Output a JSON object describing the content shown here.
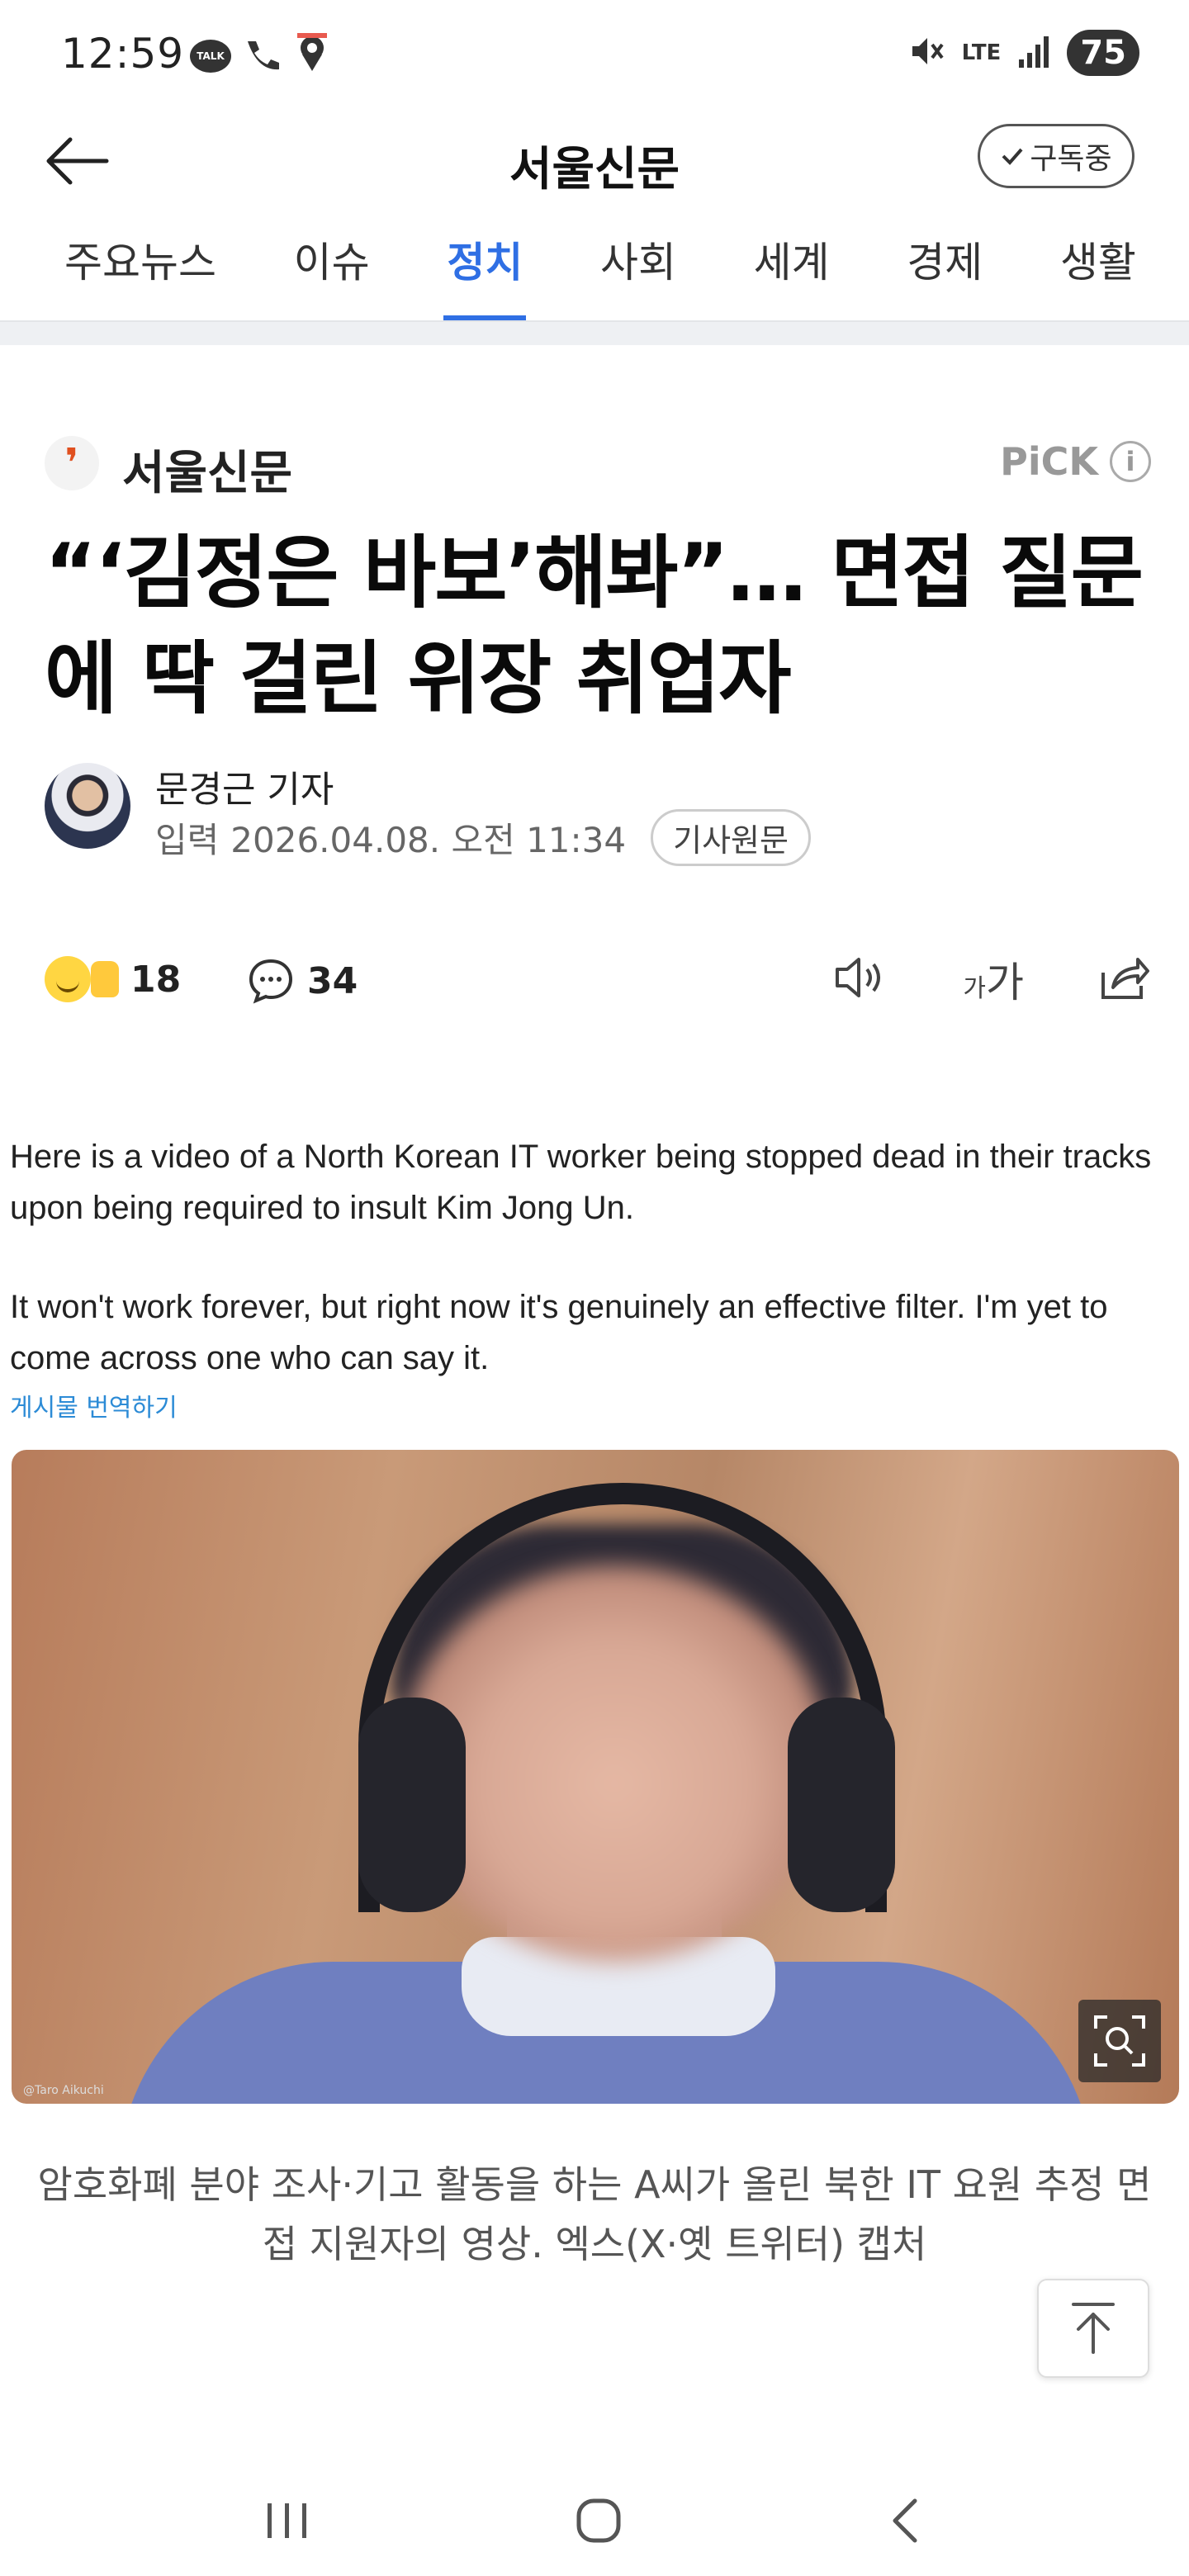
{
  "status_bar": {
    "time": "12:59",
    "talk_badge": "TALK",
    "battery": "75",
    "network": "LTE"
  },
  "header": {
    "title": "서울신문",
    "subscribe_label": "구독중"
  },
  "tabs": [
    {
      "label": "주요뉴스",
      "active": false
    },
    {
      "label": "이슈",
      "active": false
    },
    {
      "label": "정치",
      "active": true
    },
    {
      "label": "사회",
      "active": false
    },
    {
      "label": "세계",
      "active": false
    },
    {
      "label": "경제",
      "active": false
    },
    {
      "label": "생활",
      "active": false
    }
  ],
  "article": {
    "press_logo_mark": "❜",
    "press_name": "서울신문",
    "pick_label": "PiCK",
    "pick_info": "i",
    "headline": "“‘김정은 바보’해봐”… 면접 질문에 딱 걸린 위장 취업자",
    "author": "문경근 기자",
    "date_label": "입력",
    "date": "2026.04.08. 오전 11:34",
    "origin_button": "기사원문",
    "reaction_count": "18",
    "comment_count": "34",
    "font_size_small": "가",
    "font_size_large": "가"
  },
  "embed": {
    "tweet_para1": "Here is a video of a North Korean IT worker being stopped dead in their tracks upon being required to insult Kim Jong Un.",
    "tweet_para2": "It won't work forever, but right now it's genuinely an effective filter. I'm yet to come across one who can say it.",
    "translate_link": "게시물 번역하기",
    "photo_credit": "@Taro Aikuchi"
  },
  "caption": "암호화폐 분야 조사·기고 활동을 하는 A씨가 올린 북한 IT 요원 추정 면접 지원자의 영상. 엑스(X·옛 트위터) 캡처",
  "colors": {
    "accent": "#2f6fe4",
    "press_logo": "#e0501f"
  }
}
